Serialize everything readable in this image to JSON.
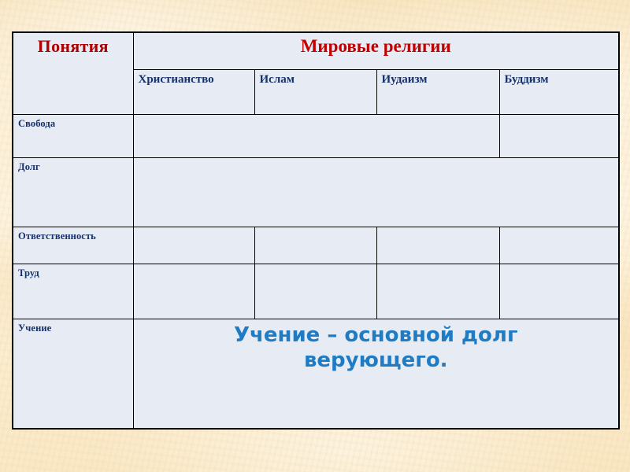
{
  "slide": {
    "background_color": "#fbeccd",
    "table_fill_color": "#e7ebf4",
    "border_color": "#000000",
    "heading_red": "#c10000",
    "label_navy": "#15306b",
    "accent_blue": "#1f7cc4"
  },
  "table": {
    "concepts_header": "Понятия",
    "religions_header": "Мировые религии",
    "religion_columns": [
      "Христианство",
      "Ислам",
      "Иудаизм",
      "Буддизм"
    ],
    "rows": [
      {
        "label": "Свобода",
        "cells": [
          "",
          ""
        ]
      },
      {
        "label": "Долг",
        "cells": [
          ""
        ]
      },
      {
        "label": "Ответственность",
        "cells": [
          "",
          "",
          "",
          ""
        ]
      },
      {
        "label": "Труд",
        "cells": [
          "",
          "",
          "",
          ""
        ]
      },
      {
        "label": "Учение",
        "cells": [
          "Учение – основной долг верующего."
        ]
      }
    ],
    "conclusion": "Учение – основной долг верующего."
  }
}
